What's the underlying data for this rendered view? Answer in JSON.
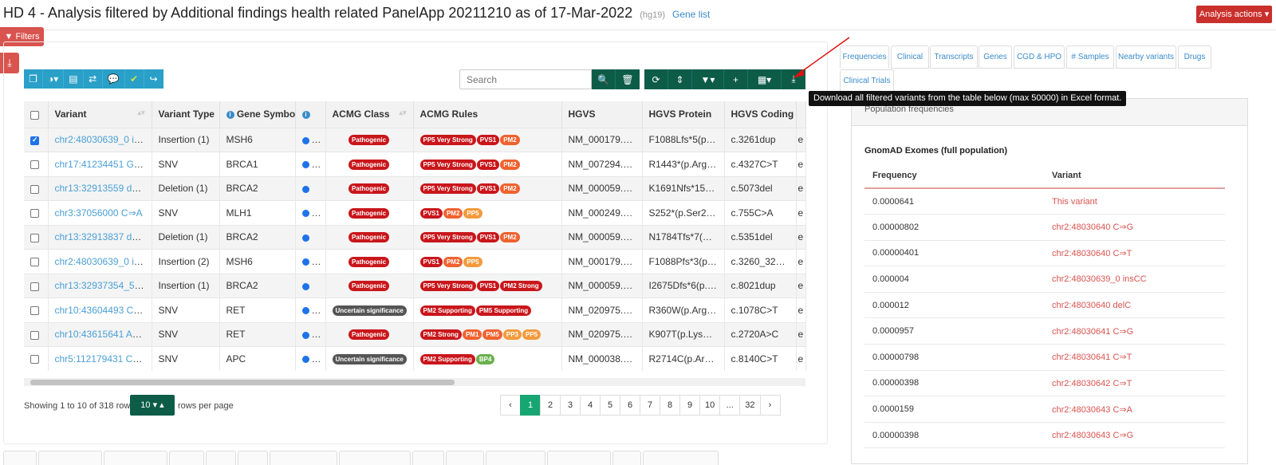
{
  "header": {
    "title": "HD 4 - Analysis filtered by Additional findings health related PanelApp 20211210 as of 17-Mar-2022",
    "build": "(hg19)",
    "gene_list": "Gene list",
    "analysis_actions": "Analysis actions ▾"
  },
  "filters_label": "Filters",
  "search": {
    "placeholder": "Search"
  },
  "tooltip": "Download all filtered variants from the table below (max 50000) in Excel format.",
  "table": {
    "headers": [
      "",
      "Variant",
      "Variant Type",
      "Gene Symbol",
      "",
      "ACMG Class",
      "ACMG Rules",
      "HGVS",
      "HGVS Protein",
      "HGVS Coding",
      ""
    ],
    "rows": [
      {
        "checked": true,
        "variant": "chr2:48030639_0 insC",
        "comment": true,
        "type": "Insertion (1)",
        "gene": "MSH6",
        "dots": [
          "#1e73e8",
          "#2bc23b"
        ],
        "cls": "Pathogenic",
        "rules": [
          [
            "PP5 Very Strong",
            "red"
          ],
          [
            "PVS1",
            "red"
          ],
          [
            "PM2",
            "orange"
          ]
        ],
        "hgvs": "NM_000179.3:c.3261dup",
        "protein": "F1088Lfs*5(p.Phe1088LeufsTer5)",
        "coding": "c.3261dup",
        "extra": "e"
      },
      {
        "checked": false,
        "variant": "chr17:41234451 G⇒A",
        "comment": false,
        "type": "SNV",
        "gene": "BRCA1",
        "dots": [
          "#1e73e8",
          "#1e8b2a"
        ],
        "cls": "Pathogenic",
        "rules": [
          [
            "PP5 Very Strong",
            "red"
          ],
          [
            "PVS1",
            "red"
          ],
          [
            "PM2",
            "orange"
          ]
        ],
        "hgvs": "NM_007294.4:c.4327C>T",
        "protein": "R1443*(p.Arg1443Ter)",
        "coding": "c.4327C>T",
        "extra": "e"
      },
      {
        "checked": false,
        "variant": "chr13:32913559 delA",
        "comment": true,
        "type": "Deletion (1)",
        "gene": "BRCA2",
        "dots": [
          "#1e73e8"
        ],
        "cls": "Pathogenic",
        "rules": [
          [
            "PP5 Very Strong",
            "red"
          ],
          [
            "PVS1",
            "red"
          ],
          [
            "PM2",
            "orange"
          ]
        ],
        "hgvs": "NM_000059.4:c.5073del",
        "protein": "K1691Nfs*15(p.Lys1691AsnfsTer15)",
        "coding": "c.5073del",
        "extra": "e"
      },
      {
        "checked": false,
        "variant": "chr3:37056000 C⇒A",
        "comment": false,
        "type": "SNV",
        "gene": "MLH1",
        "dots": [
          "#1e73e8",
          "#e8e8e8"
        ],
        "cls": "Pathogenic",
        "rules": [
          [
            "PVS1",
            "red"
          ],
          [
            "PM2",
            "orange"
          ],
          [
            "PP5",
            "lorange"
          ]
        ],
        "hgvs": "NM_000249.4:c.755C>A",
        "protein": "S252*(p.Ser252Ter)",
        "coding": "c.755C>A",
        "extra": "e"
      },
      {
        "checked": false,
        "variant": "chr13:32913837 delA",
        "comment": false,
        "type": "Deletion (1)",
        "gene": "BRCA2",
        "dots": [
          "#1e73e8"
        ],
        "cls": "Pathogenic",
        "rules": [
          [
            "PP5 Very Strong",
            "red"
          ],
          [
            "PVS1",
            "red"
          ],
          [
            "PM2",
            "orange"
          ]
        ],
        "hgvs": "NM_000059.4:c.5351del",
        "protein": "N1784Tfs*7(p.Asn1784ThrfsTer7)",
        "coding": "c.5351del",
        "extra": "e"
      },
      {
        "checked": false,
        "variant": "chr2:48030639_0 insCC",
        "comment": false,
        "type": "Insertion (2)",
        "gene": "MSH6",
        "dots": [
          "#1e73e8",
          "#e8e8e8"
        ],
        "cls": "Pathogenic",
        "rules": [
          [
            "PVS1",
            "red"
          ],
          [
            "PM2",
            "orange"
          ],
          [
            "PP5",
            "lorange"
          ]
        ],
        "hgvs": "NM_000179.3:c.3260_3261dup",
        "protein": "F1088Pfs*3(p.Phe1088ProfsTer3)",
        "coding": "c.3260_3261dup",
        "extra": "e"
      },
      {
        "checked": false,
        "variant": "chr13:32937354_5 insA",
        "comment": false,
        "type": "Insertion (1)",
        "gene": "BRCA2",
        "dots": [
          "#1e73e8"
        ],
        "cls": "Pathogenic",
        "rules": [
          [
            "PP5 Very Strong",
            "red"
          ],
          [
            "PVS1",
            "red"
          ],
          [
            "PM2 Strong",
            "red"
          ]
        ],
        "hgvs": "NM_000059.4:c.8021dup",
        "protein": "I2675Dfs*6(p.Ile2675AspfsTer6)",
        "coding": "c.8021dup",
        "extra": "e"
      },
      {
        "checked": false,
        "variant": "chr10:43604493 C⇒T",
        "comment": false,
        "type": "SNV",
        "gene": "RET",
        "dots": [
          "#1e73e8",
          "#e8e8e8"
        ],
        "cls": "Uncertain significance",
        "clsB": "B",
        "rules": [
          [
            "PM2 Supporting",
            "red"
          ],
          [
            "PM5 Supporting",
            "red"
          ],
          [
            "PP3",
            "lorange"
          ],
          [
            "PP5",
            "lorange"
          ]
        ],
        "hgvs": "NM_020975.6:c.1078C>T",
        "protein": "R360W(p.Arg360Trp)",
        "coding": "c.1078C>T",
        "extra": "e"
      },
      {
        "checked": false,
        "variant": "chr10:43615641 A⇒C",
        "comment": false,
        "type": "SNV",
        "gene": "RET",
        "dots": [
          "#1e73e8",
          "#e8e8e8"
        ],
        "cls": "Pathogenic",
        "rules": [
          [
            "PM2 Strong",
            "red"
          ],
          [
            "PM1",
            "orange"
          ],
          [
            "PM5",
            "orange"
          ],
          [
            "PP3",
            "lorange"
          ],
          [
            "PP5",
            "lorange"
          ]
        ],
        "hgvs": "NM_020975.6:c.2720A>C",
        "protein": "K907T(p.Lys907Thr)",
        "coding": "c.2720A>C",
        "extra": "e"
      },
      {
        "checked": false,
        "variant": "chr5:112179431 C⇒T",
        "comment": false,
        "type": "SNV",
        "gene": "APC",
        "dots": [
          "#1e73e8",
          "#e8e8e8"
        ],
        "cls": "Uncertain significance",
        "clsB": "B",
        "rules": [
          [
            "PM2 Supporting",
            "red"
          ],
          [
            "BP4",
            "green"
          ]
        ],
        "hgvs": "NM_000038.6:c.8140C>T",
        "protein": "R2714C(p.Arg2714Cys)",
        "coding": "c.8140C>T",
        "extra": "e"
      }
    ]
  },
  "footer": {
    "showing": "Showing 1 to 10 of 318 rows",
    "rpp_value": "10 ▾ ▴",
    "rpp_label": "rows per page",
    "pages": [
      "‹",
      "1",
      "2",
      "3",
      "4",
      "5",
      "6",
      "7",
      "8",
      "9",
      "10",
      "...",
      "32",
      "›"
    ]
  },
  "right_tabs": [
    "Frequencies",
    "Clinical",
    "Transcripts",
    "Genes",
    "CGD & HPO",
    "# Samples",
    "Nearby variants",
    "Drugs",
    "Clinical Trials"
  ],
  "population": {
    "header": "Population frequencies",
    "title": "GnomAD Exomes (full population)",
    "col_freq": "Frequency",
    "col_variant": "Variant",
    "rows": [
      [
        "0.0000641",
        "This variant"
      ],
      [
        "0.00000802",
        "chr2:48030640 C⇒G"
      ],
      [
        "0.00000401",
        "chr2:48030640 C⇒T"
      ],
      [
        "0.000004",
        "chr2:48030639_0 insCC"
      ],
      [
        "0.000012",
        "chr2:48030640 delC"
      ],
      [
        "0.0000957",
        "chr2:48030641 C⇒G"
      ],
      [
        "0.00000798",
        "chr2:48030641 C⇒T"
      ],
      [
        "0.00000398",
        "chr2:48030642 C⇒T"
      ],
      [
        "0.0000159",
        "chr2:48030643 C⇒A"
      ],
      [
        "0.00000398",
        "chr2:48030643 C⇒G"
      ]
    ]
  },
  "colors": {
    "accent_dark": "#0d5c48",
    "accent_teal": "#2aa0c8",
    "danger": "#d9534f",
    "active_page": "#18a574"
  }
}
